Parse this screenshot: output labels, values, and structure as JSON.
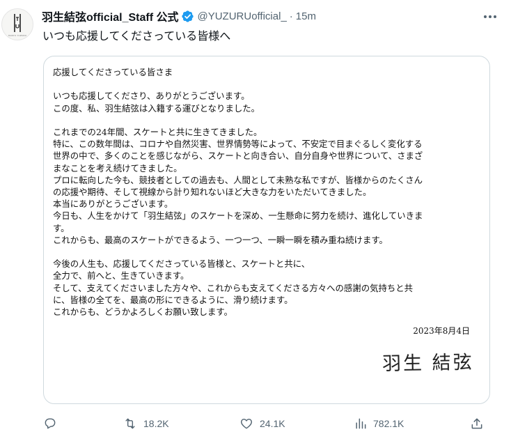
{
  "author": {
    "display_name": "羽生結弦official_Staff 公式",
    "handle": "@YUZURUofficial_",
    "separator": "·",
    "time": "15m",
    "avatar_caption": "HANYU YUZURU"
  },
  "tweet": {
    "text": "いつも応援してくださっている皆様へ"
  },
  "letter": {
    "lines": [
      "応援してくださっている皆さま",
      "",
      "いつも応援してくださり、ありがとうございます。",
      "この度、私、羽生結弦は入籍する運びとなりました。",
      "",
      "これまでの24年間、スケートと共に生きてきました。",
      "特に、この数年間は、コロナや自然災害、世界情勢等によって、不安定で目まぐるしく変化する",
      "世界の中で、多くのことを感じながら、スケートと向き合い、自分自身や世界について、さまざ",
      "まなことを考え続けてきました。",
      "プロに転向した今も、競技者としての過去も、人間として未熟な私ですが、皆様からのたくさん",
      "の応援や期待、そして視線から計り知れないほど大きな力をいただいてきました。",
      "本当にありがとうございます。",
      "今日も、人生をかけて「羽生結弦」のスケートを深め、一生懸命に努力を続け、進化していきま",
      "す。",
      "これからも、最高のスケートができるよう、一つ一つ、一瞬一瞬を積み重ね続けます。",
      "",
      "今後の人生も、応援してくださっている皆様と、スケートと共に、",
      "全力で、前へと、生きていきます。",
      "そして、支えてくださいました方々や、これからも支えてくださる方々への感謝の気持ちと共",
      "に、皆様の全てを、最高の形にできるように、滑り続けます。",
      "これからも、どうかよろしくお願い致します。"
    ],
    "date": "2023年8月4日",
    "signature": "羽生 結弦"
  },
  "actions": {
    "replies": "",
    "retweets": "18.2K",
    "likes": "24.1K",
    "views": "782.1K"
  },
  "colors": {
    "text": "#0f1419",
    "secondary": "#536471",
    "verified": "#1d9bf0",
    "border": "#cfd9de"
  },
  "icons": {
    "reply": "reply-icon",
    "retweet": "retweet-icon",
    "like": "heart-icon",
    "views": "views-icon",
    "share": "share-icon",
    "verified": "verified-badge-icon",
    "more": "more-icon"
  }
}
